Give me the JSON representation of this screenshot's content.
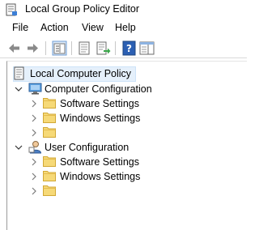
{
  "window": {
    "title": "Local Group Policy Editor",
    "app_icon": "policy-editor-icon"
  },
  "menu": [
    "File",
    "Action",
    "View",
    "Help"
  ],
  "toolbar": {
    "buttons": [
      "back-arrow-icon",
      "forward-arrow-icon",
      "show-hide-tree-icon",
      "properties-icon",
      "export-list-icon",
      "help-icon",
      "show-hide-action-pane-icon"
    ]
  },
  "tree": {
    "root": {
      "label": "Local Computer Policy",
      "icon": "policy-document-icon"
    },
    "computer_configuration": {
      "label": "Computer Configuration",
      "icon": "computer-icon",
      "children": [
        {
          "label": "Software Settings"
        },
        {
          "label": "Windows Settings"
        },
        {
          "label": ""
        }
      ]
    },
    "user_configuration": {
      "label": "User Configuration",
      "icon": "user-icon",
      "children": [
        {
          "label": "Software Settings"
        },
        {
          "label": "Windows Settings"
        },
        {
          "label": ""
        }
      ]
    }
  },
  "colors": {
    "selection": "#e5f0fb",
    "folder": "#f2d06b",
    "folder_edge": "#d4a72c"
  }
}
